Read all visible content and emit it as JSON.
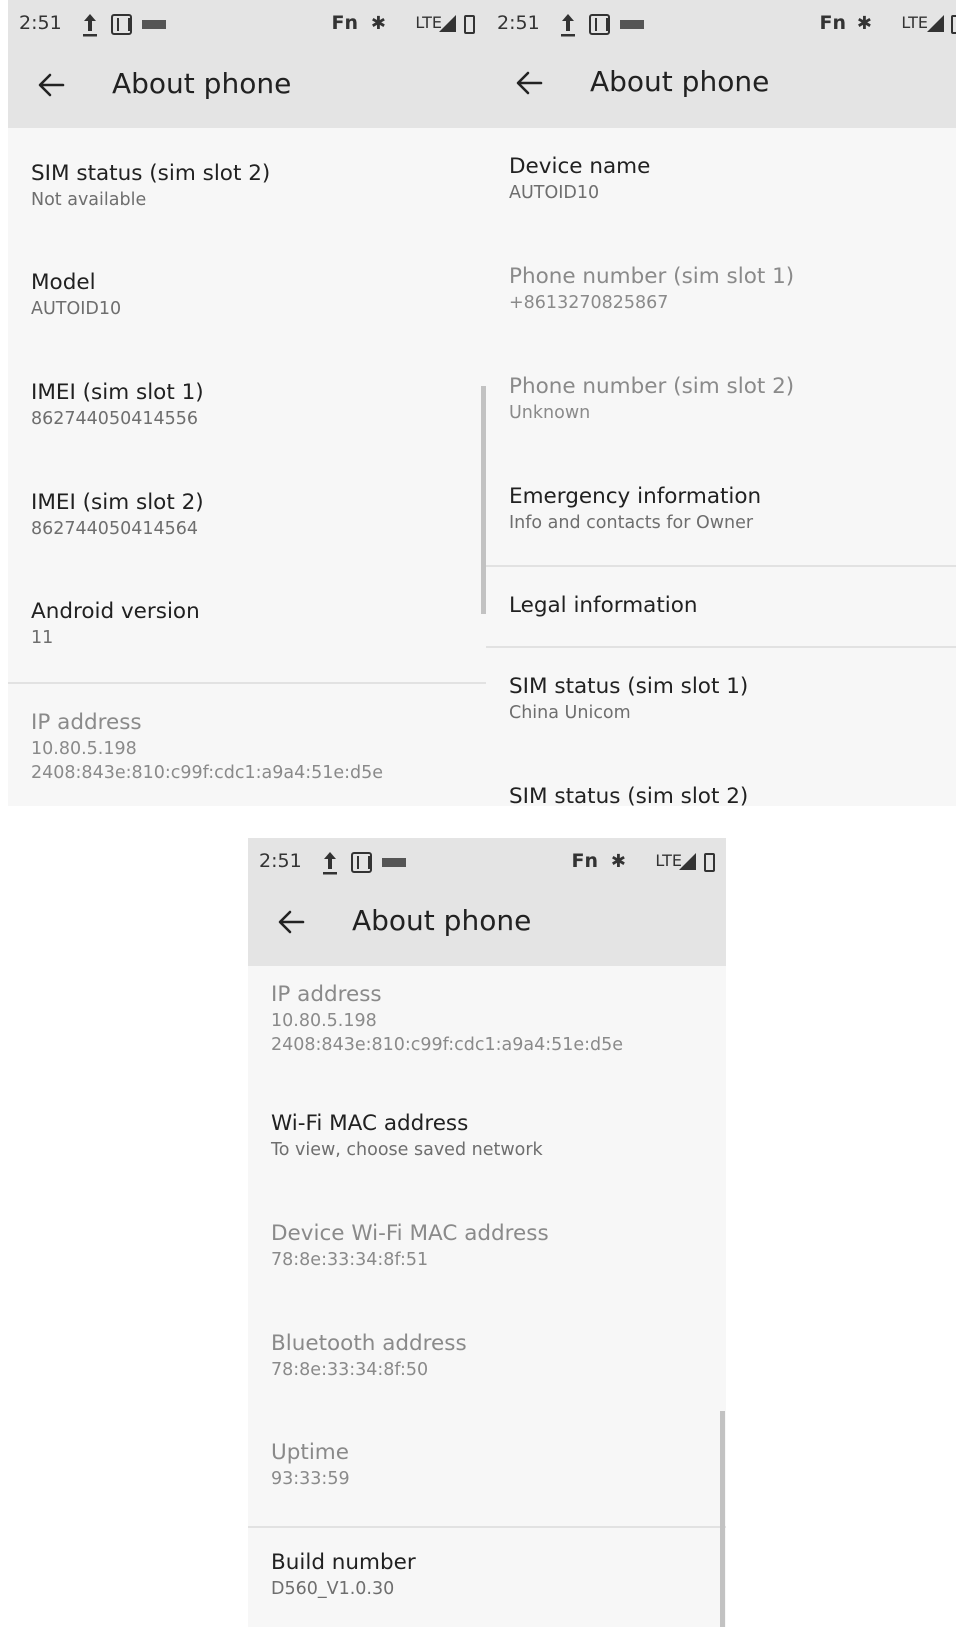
{
  "screens": [
    {
      "status": {
        "time": "2:51",
        "fn": "Fn",
        "lte": "LTE",
        "bluetooth_glyph": "✱"
      },
      "appbar": {
        "title": "About phone"
      },
      "items": [
        {
          "title": "SIM status (sim slot 2)",
          "sub": "Not available"
        },
        {
          "title": "Model",
          "sub": "AUTOID10"
        },
        {
          "title": "IMEI (sim slot 1)",
          "sub": "862744050414556"
        },
        {
          "title": "IMEI (sim slot 2)",
          "sub": "862744050414564"
        },
        {
          "title": "Android version",
          "sub": "11"
        },
        {
          "title": "IP address",
          "sub": "10.80.5.198",
          "sub2": "2408:843e:810:c99f:cdc1:a9a4:51e:d5e"
        }
      ]
    },
    {
      "status": {
        "time": "2:51",
        "fn": "Fn",
        "lte": "LTE",
        "bluetooth_glyph": "✱"
      },
      "appbar": {
        "title": "About phone"
      },
      "items": [
        {
          "title": "Device name",
          "sub": "AUTOID10"
        },
        {
          "title": "Phone number (sim slot 1)",
          "sub": "+8613270825867"
        },
        {
          "title": "Phone number (sim slot 2)",
          "sub": "Unknown"
        },
        {
          "title": "Emergency information",
          "sub": "Info and contacts for Owner"
        },
        {
          "title": "Legal information"
        },
        {
          "title": "SIM status (sim slot 1)",
          "sub": "China Unicom"
        },
        {
          "title": "SIM status (sim slot 2)"
        }
      ]
    },
    {
      "status": {
        "time": "2:51",
        "fn": "Fn",
        "lte": "LTE",
        "bluetooth_glyph": "✱"
      },
      "appbar": {
        "title": "About phone"
      },
      "items": [
        {
          "title": "IP address",
          "sub": "10.80.5.198",
          "sub2": "2408:843e:810:c99f:cdc1:a9a4:51e:d5e"
        },
        {
          "title": "Wi-Fi MAC address",
          "sub": "To view, choose saved network"
        },
        {
          "title": "Device Wi-Fi MAC address",
          "sub": "78:8e:33:34:8f:51"
        },
        {
          "title": "Bluetooth address",
          "sub": "78:8e:33:34:8f:50"
        },
        {
          "title": "Uptime",
          "sub": "93:33:59"
        },
        {
          "title": "Build number",
          "sub": "D560_V1.0.30"
        }
      ]
    }
  ]
}
